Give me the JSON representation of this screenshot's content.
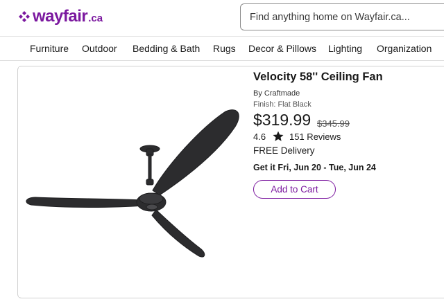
{
  "colors": {
    "brand": "#7b189f",
    "text": "#1a1a1a",
    "border": "#d0d0d0"
  },
  "header": {
    "logo_text": "wayfair",
    "logo_tld": ".ca",
    "logo_icon": "wayfair-pinwheel-icon",
    "search_placeholder": "Find anything home on Wayfair.ca..."
  },
  "nav": {
    "items": [
      {
        "label": "Furniture"
      },
      {
        "label": "Outdoor"
      },
      {
        "label": "Bedding & Bath"
      },
      {
        "label": "Rugs"
      },
      {
        "label": "Decor & Pillows"
      },
      {
        "label": "Lighting"
      },
      {
        "label": "Organization"
      }
    ]
  },
  "product": {
    "image_icon": "ceiling-fan-image",
    "title": "Velocity 58'' Ceiling Fan",
    "brand_line": "By Craftmade",
    "finish_line": "Finish: Flat Black",
    "price": "$319.99",
    "old_price": "$345.99",
    "rating": "4.6",
    "star_icon": "star-icon",
    "reviews": "151 Reviews",
    "delivery": "FREE Delivery",
    "get_it": "Get it Fri, Jun 20 - Tue, Jun 24",
    "add_to_cart": "Add to Cart"
  }
}
